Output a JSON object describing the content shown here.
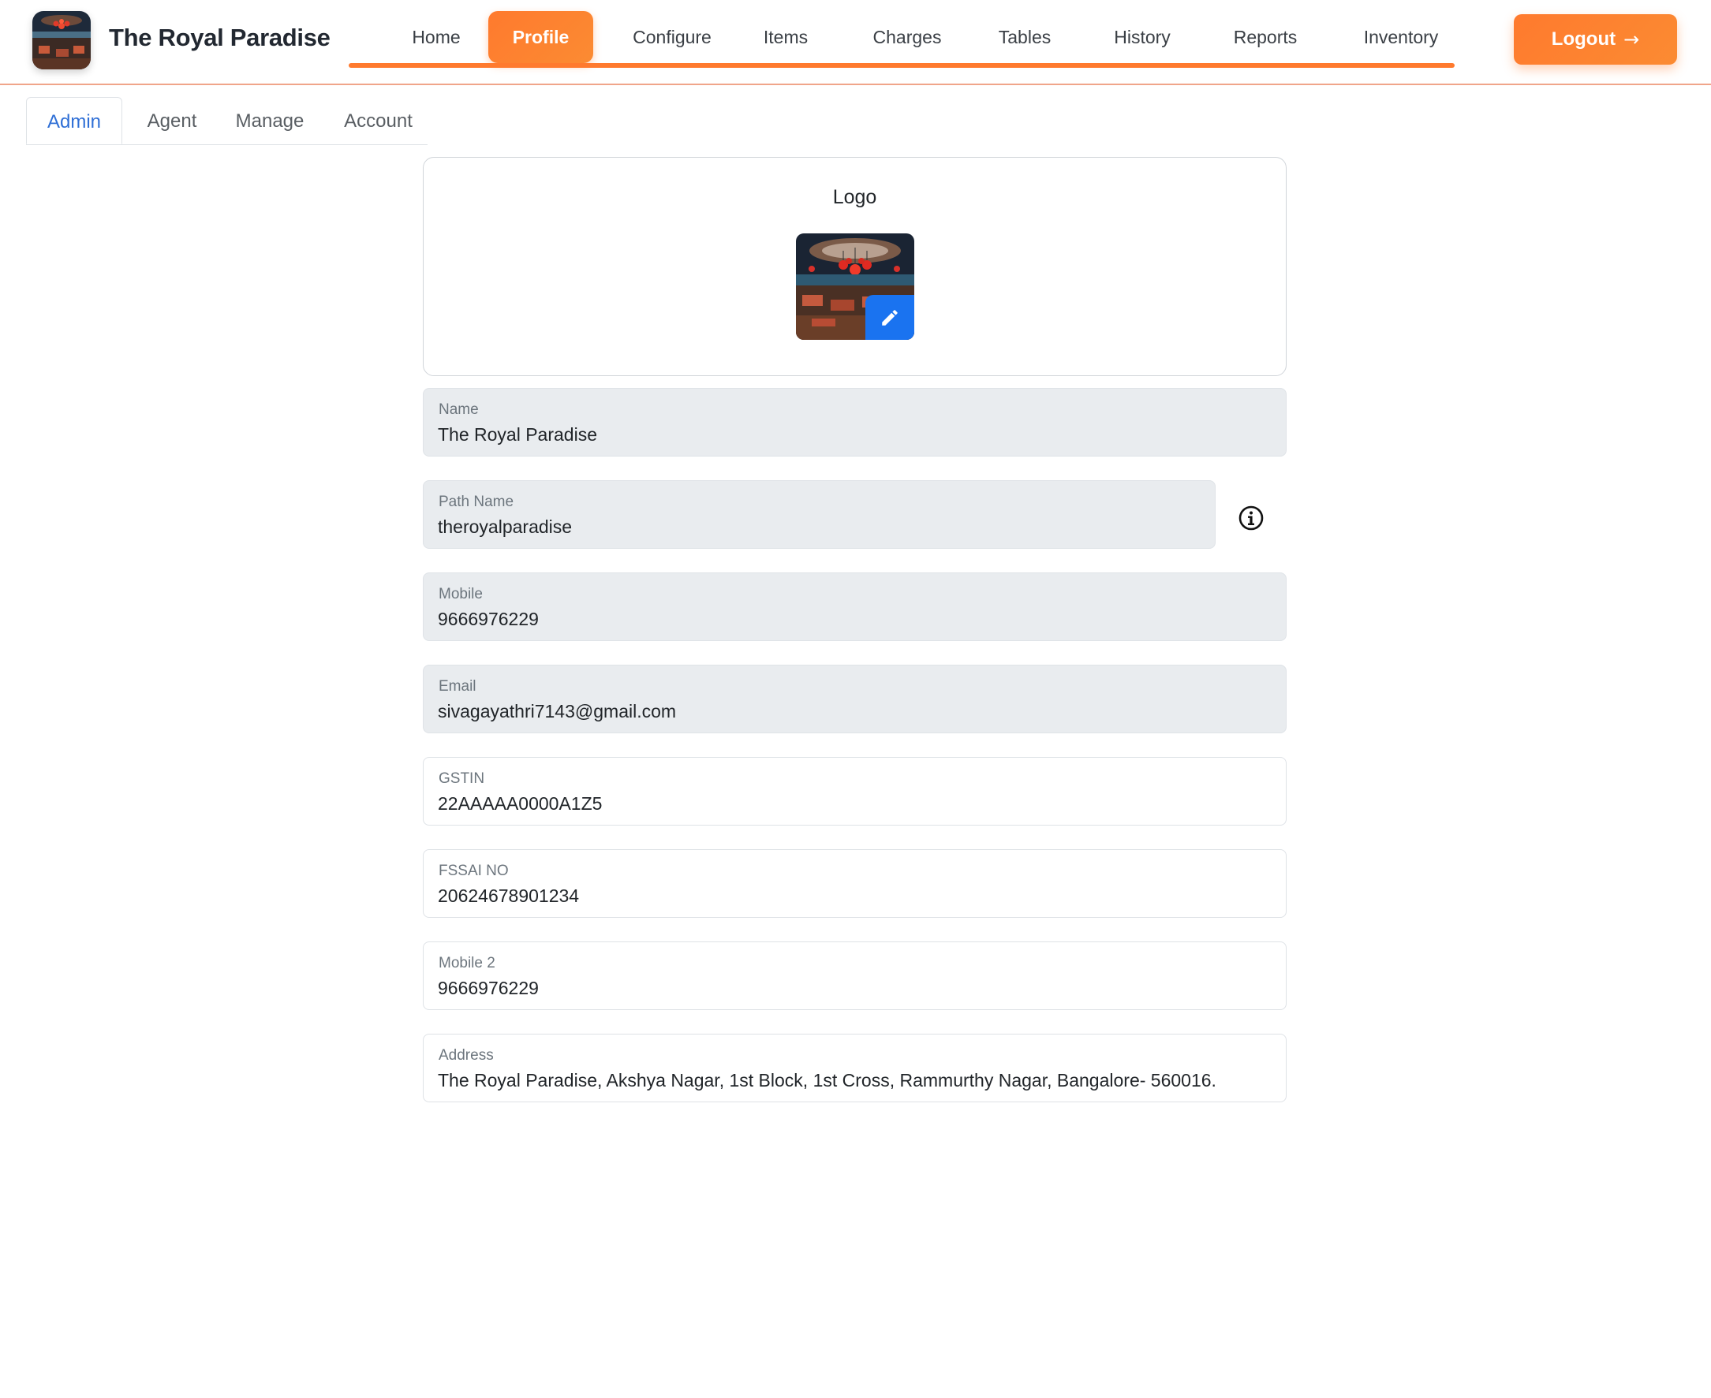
{
  "brand": {
    "name": "The Royal Paradise"
  },
  "nav": {
    "items": [
      {
        "label": "Home",
        "active": false
      },
      {
        "label": "Profile",
        "active": true
      },
      {
        "label": "Configure",
        "active": false
      },
      {
        "label": "Items",
        "active": false
      },
      {
        "label": "Charges",
        "active": false
      },
      {
        "label": "Tables",
        "active": false
      },
      {
        "label": "History",
        "active": false
      },
      {
        "label": "Reports",
        "active": false
      },
      {
        "label": "Inventory",
        "active": false
      }
    ],
    "logout_label": "Logout",
    "logout_icon": "arrow-right-icon"
  },
  "subtabs": [
    {
      "label": "Admin",
      "active": true
    },
    {
      "label": "Agent",
      "active": false
    },
    {
      "label": "Manage",
      "active": false
    },
    {
      "label": "Account",
      "active": false
    }
  ],
  "logo_card": {
    "title": "Logo",
    "edit_icon": "pencil-icon"
  },
  "fields": {
    "name": {
      "label": "Name",
      "value": "The Royal Paradise",
      "disabled": true
    },
    "path_name": {
      "label": "Path Name",
      "value": "theroyalparadise",
      "disabled": true,
      "info_icon": "info-icon"
    },
    "mobile": {
      "label": "Mobile",
      "value": "9666976229",
      "disabled": true
    },
    "email": {
      "label": "Email",
      "value": "sivagayathri7143@gmail.com",
      "disabled": true
    },
    "gstin": {
      "label": "GSTIN",
      "value": "22AAAAA0000A1Z5",
      "disabled": false
    },
    "fssai": {
      "label": "FSSAI NO",
      "value": "20624678901234",
      "disabled": false
    },
    "mobile2": {
      "label": "Mobile 2",
      "value": "9666976229",
      "disabled": false
    },
    "address": {
      "label": "Address",
      "value": "The Royal Paradise, Akshya Nagar, 1st Block, 1st Cross, Rammurthy Nagar, Bangalore- 560016.",
      "disabled": false
    }
  },
  "colors": {
    "accent": "#ff7a2e",
    "active_tab_text": "#2f6fd6",
    "edit_button": "#1a73f0",
    "disabled_field_bg": "#e9ecef"
  }
}
